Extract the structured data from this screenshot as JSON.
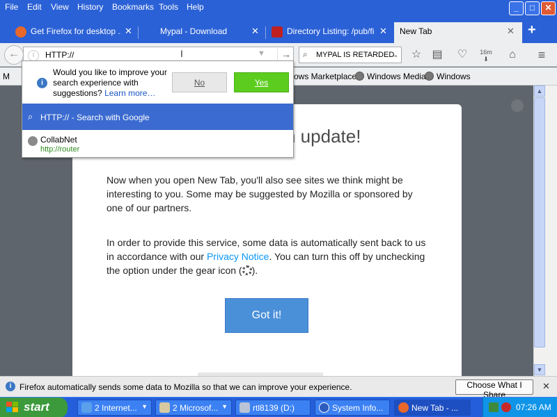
{
  "menu": [
    "File",
    "Edit",
    "View",
    "History",
    "Bookmarks",
    "Tools",
    "Help"
  ],
  "window_buttons": {
    "minimize": "_",
    "maximize": "□",
    "close": "✕"
  },
  "tabs": [
    {
      "label": "Get Firefox for desktop ...",
      "active": false
    },
    {
      "label": "Mypal - Download",
      "active": false
    },
    {
      "label": "Directory Listing: /pub/fi...",
      "active": false
    },
    {
      "label": "New Tab",
      "active": true
    }
  ],
  "new_tab_label": "+",
  "urlbar": {
    "value": "HTTP://",
    "go": "→"
  },
  "searchbar": {
    "value": "MYPAL IS RETARDED",
    "go": "→"
  },
  "toolbar": {
    "pocket_badge": "16m"
  },
  "bookmarks": [
    {
      "label": "M"
    },
    {
      "label": "ows Marketplace"
    },
    {
      "label": "Windows Media"
    },
    {
      "label": "Windows"
    }
  ],
  "popup": {
    "prompt": "Would you like to improve your search experience with suggestions?",
    "learn_more": "Learn more…",
    "no": "No",
    "yes": "Yes",
    "search_row": "HTTP:// - Search with Google",
    "history_title": "CollabNet",
    "history_url": "http://router"
  },
  "card": {
    "headline": "n update!",
    "para1": "Now when you open New Tab, you'll also see sites we think might be interesting to you. Some may be suggested by Mozilla or sponsored by one of our partners.",
    "para2_a": "In order to provide this service, some data is automatically sent back to us in accordance with our ",
    "privacy_link": "Privacy Notice",
    "para2_b": ". You can turn this off by unchecking the option under the gear icon (",
    "para2_c": ").",
    "button": "Got it!"
  },
  "notification": {
    "text": "Firefox automatically sends some data to Mozilla so that we can improve your experience.",
    "button": "Choose What I Share",
    "close": "✕"
  },
  "taskbar": {
    "start": "start",
    "items": [
      {
        "label": "2 Internet..."
      },
      {
        "label": "2 Microsof..."
      },
      {
        "label": "rtl8139 (D:)"
      },
      {
        "label": "System Info..."
      },
      {
        "label": "New Tab - ..."
      }
    ],
    "clock": "07:26 AM"
  },
  "colors": {
    "accent_blue": "#3b6bd0",
    "yes_green": "#5ccd1f",
    "got_it": "#4a90d9",
    "xp_blue": "#245edb"
  }
}
